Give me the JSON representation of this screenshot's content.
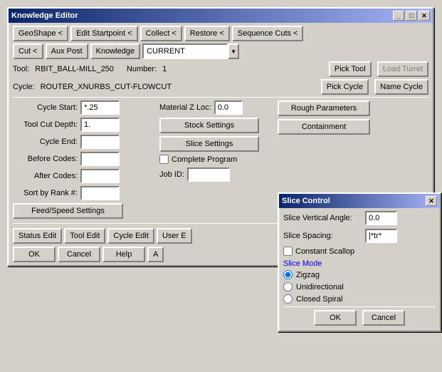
{
  "mainWindow": {
    "title": "Knowledge Editor",
    "toolbar1": {
      "btn1": "GeoShape <",
      "btn2": "Edit Startpoint <",
      "btn3": "Collect <",
      "btn4": "Restore <",
      "btn5": "Sequence Cuts <"
    },
    "toolbar2": {
      "btn1": "Cut <",
      "btn2": "Aux Post",
      "btn3": "Knowledge",
      "dropdown": "CURRENT"
    },
    "toolRow": {
      "toolLabel": "Tool:",
      "toolValue": "RBIT_BALL-MILL_250",
      "numberLabel": "Number:",
      "numberValue": "1",
      "pickToolBtn": "Pick Tool",
      "loadTurretBtn": "Load Turret"
    },
    "cycleRow": {
      "cycleLabel": "Cycle:",
      "cycleValue": "ROUTER_XNURBS_CUT-FLOWCUT",
      "pickCycleBtn": "Pick Cycle",
      "nameCycleBtn": "Name Cycle"
    },
    "leftPanel": {
      "cycleStartLabel": "Cycle Start:",
      "cycleStartValue": "*.25",
      "toolCutDepthLabel": "Tool Cut Depth:",
      "toolCutDepthValue": "1.",
      "cycleEndLabel": "Cycle End:",
      "cycleEndValue": "",
      "beforeCodesLabel": "Before Codes:",
      "beforeCodesValue": "",
      "afterCodesLabel": "After Codes:",
      "afterCodesValue": "",
      "sortByRankLabel": "Sort by Rank #:",
      "sortByRankValue": "",
      "feedSpeedBtn": "Feed/Speed Settings"
    },
    "middlePanel": {
      "materialZLocLabel": "Material Z Loc:",
      "materialZLocValue": "0.0",
      "stockSettingsBtn": "Stock Settings",
      "sliceSettingsBtn": "Slice Settings",
      "completeProgramLabel": "Complete Program",
      "jobIDLabel": "Job ID:",
      "jobIDValue": ""
    },
    "rightPanel": {
      "roughParamsBtn": "Rough Parameters",
      "containmentBtn": "Containment"
    },
    "bottomBar": {
      "statusEditBtn": "Status Edit",
      "toolEditBtn": "Tool Edit",
      "cycleEditBtn": "Cycle Edit",
      "userBtn": "User E",
      "okBtn": "OK",
      "cancelBtn": "Cancel",
      "helpBtn": "Help",
      "extraBtn": "A"
    }
  },
  "sliceWindow": {
    "title": "Slice Control",
    "sliceVerticalAngleLabel": "Slice Vertical Angle:",
    "sliceVerticalAngleValue": "0.0",
    "sliceSpacingLabel": "Slice Spacing:",
    "sliceSpacingValue": "|*tr*",
    "constantScallopLabel": "Constant Scallop",
    "sliceModeLabel": "Slice Mode",
    "modes": [
      "Zigzag",
      "Unidirectional",
      "Closed Spiral"
    ],
    "selectedMode": "Zigzag",
    "okBtn": "OK",
    "cancelBtn": "Cancel"
  }
}
